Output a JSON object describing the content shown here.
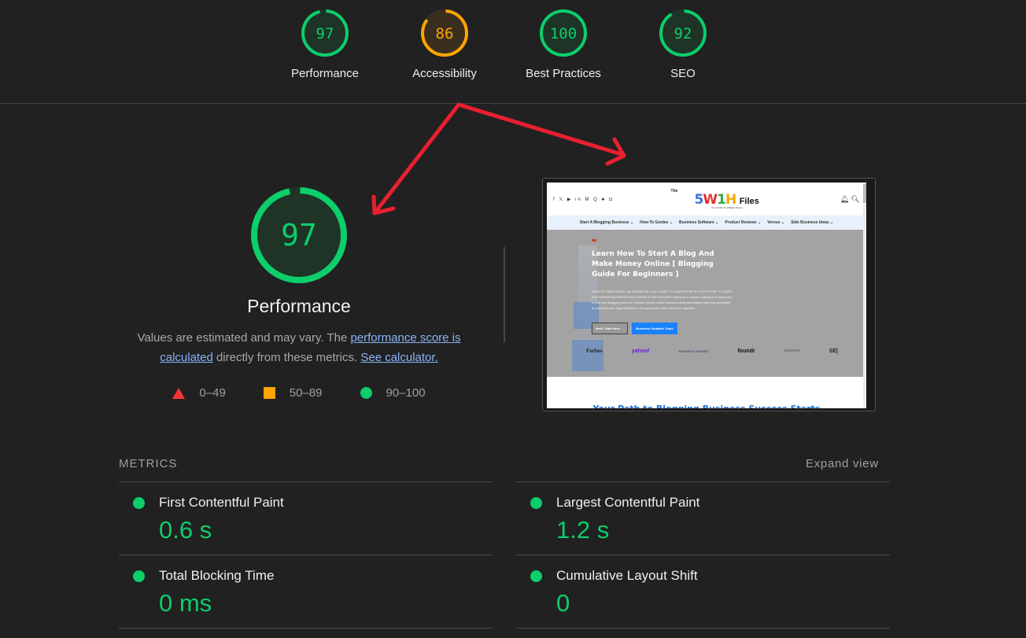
{
  "colors": {
    "pass": "#0cce6b",
    "average": "#ffa400",
    "fail": "#ff3333",
    "link": "#8ab4f8",
    "annotation_arrow": "#e8202f"
  },
  "categories": [
    {
      "label": "Performance",
      "score": 97,
      "rating": "pass"
    },
    {
      "label": "Accessibility",
      "score": 86,
      "rating": "average"
    },
    {
      "label": "Best Practices",
      "score": 100,
      "rating": "pass"
    },
    {
      "label": "SEO",
      "score": 92,
      "rating": "pass"
    }
  ],
  "performance": {
    "score": 97,
    "title": "Performance",
    "desc_prefix": "Values are estimated and may vary. The ",
    "desc_link1": "performance score is calculated",
    "desc_middle": " directly from these metrics. ",
    "desc_link2": "See calculator.",
    "legend": [
      {
        "icon": "triangle-icon",
        "range": "0–49"
      },
      {
        "icon": "square-icon",
        "range": "50–89"
      },
      {
        "icon": "circle-icon",
        "range": "90–100"
      }
    ]
  },
  "screenshot": {
    "social_icons": "f 𝕏 ▶ in M Q ♣ ◘",
    "logo_the": "The",
    "logo_brand": "5W1H",
    "logo_files": "Files",
    "logo_tagline": "Your Guide To A Better Future",
    "header_icons": "🔔︎ 🔍︎",
    "nav": [
      "Start A Blogging Business ⌄",
      "How-To Guides ⌄",
      "Business Software ⌄",
      "Product Reviews ⌄",
      "Versus ⌄",
      "Side Business Ideas ⌄"
    ],
    "hero_title": "Learn How To Start A Blog And Make Money Online [ Blogging Guide For Beginners ]",
    "hero_text": "HOW TO MAKE MONEY BLOGGING IN 2024? WANT TO LEARN STEP-BY-STEP HOW TO START A BLOGGING BUSINESS AND GROW A SIDE INCOME? Discover a curated collection of resources to fuel your blogging success. Explore proven online business ideas and digital marketing strategies to monetize your blog effectively. Let's grow your online business together!",
    "btn_primary": "New? Start Here →",
    "btn_secondary": "Business Software Tools",
    "press_logos": [
      "Forbes",
      "yahoo!",
      "BUSINESS INSIDER",
      "foundr",
      "business",
      "SE|"
    ],
    "section_title": "Your Path to Blogging Business Success Starts"
  },
  "metrics": {
    "header": "METRICS",
    "expand_label": "Expand view",
    "items": [
      {
        "title": "First Contentful Paint",
        "value": "0.6 s",
        "rating": "pass"
      },
      {
        "title": "Largest Contentful Paint",
        "value": "1.2 s",
        "rating": "pass"
      },
      {
        "title": "Total Blocking Time",
        "value": "0 ms",
        "rating": "pass"
      },
      {
        "title": "Cumulative Layout Shift",
        "value": "0",
        "rating": "pass"
      }
    ]
  }
}
